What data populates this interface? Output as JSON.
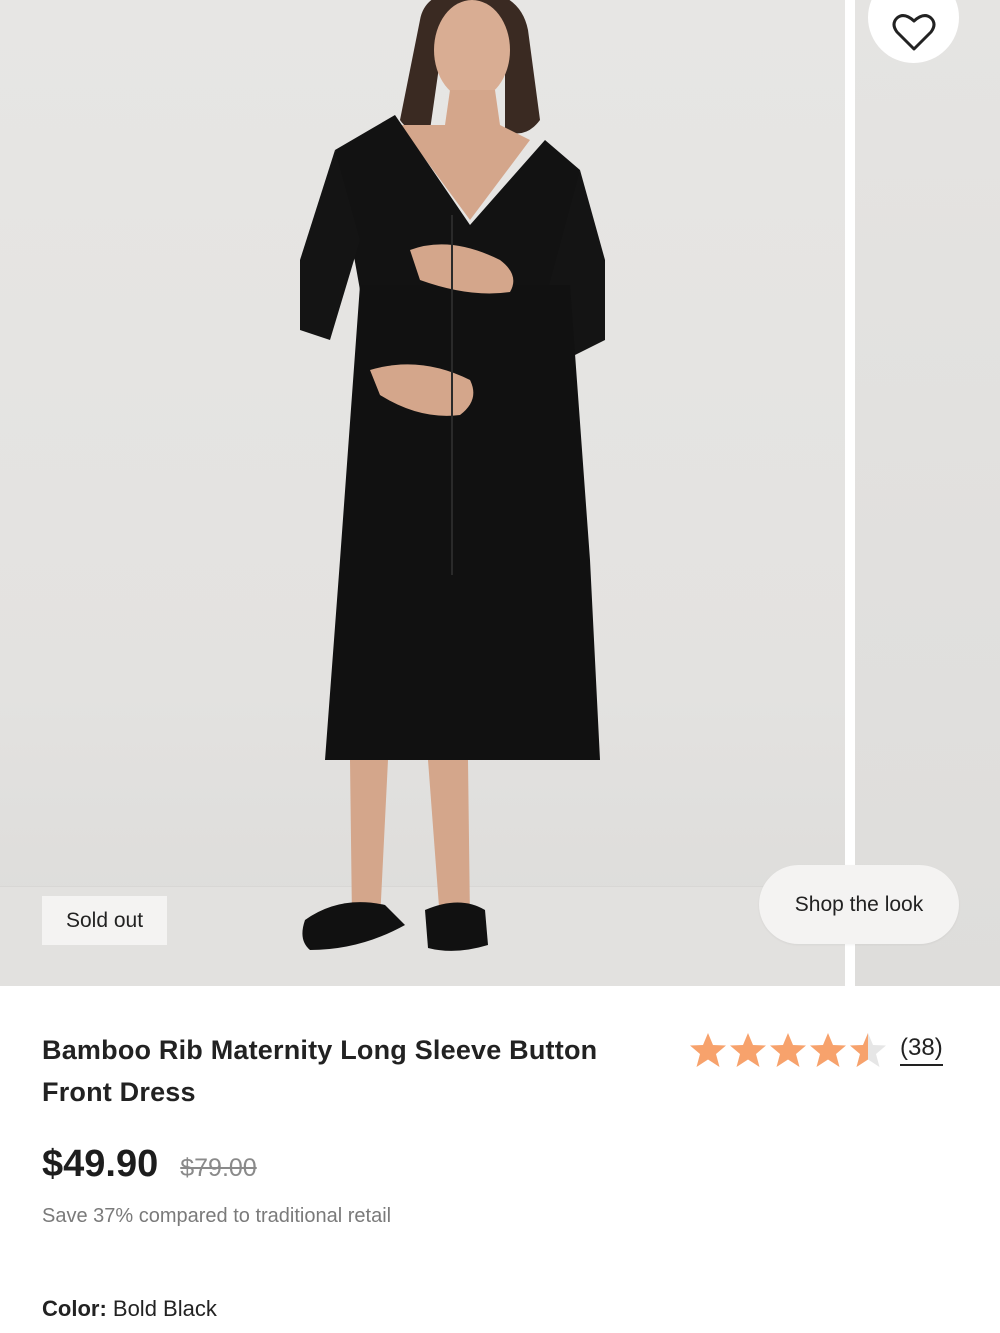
{
  "gallery": {
    "badge": "Sold out",
    "shop_the_look": "Shop the look",
    "wishlist_icon": "heart-outline-icon"
  },
  "product": {
    "title": "Bamboo Rib Maternity Long Sleeve Button Front Dress",
    "rating": {
      "value": 4.5,
      "max": 5,
      "count": "(38)",
      "star_color": "#f7a26c",
      "empty_color": "#e6e6e6"
    },
    "price": "$49.90",
    "original_price": "$79.00",
    "savings_text": "Save 37% compared to traditional retail",
    "color_label": "Color:",
    "color_value": "Bold Black"
  }
}
